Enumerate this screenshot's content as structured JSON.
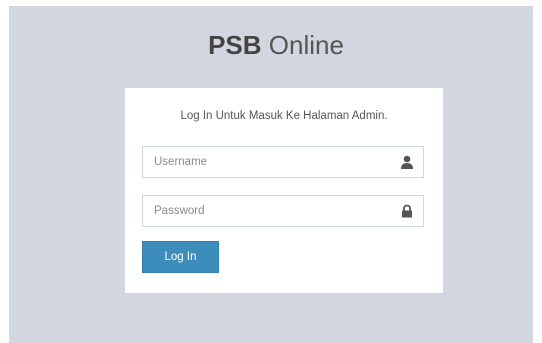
{
  "brand": {
    "strong": "PSB",
    "light": " Online"
  },
  "login_box": {
    "message": "Log In Untuk Masuk Ke Halaman Admin.",
    "username": {
      "placeholder": "Username",
      "value": "",
      "icon": "user-icon"
    },
    "password": {
      "placeholder": "Password",
      "value": "",
      "icon": "lock-icon"
    },
    "submit_label": "Log In"
  },
  "colors": {
    "page_background": "#d2d6de",
    "box_background": "#ffffff",
    "button_primary": "#3c8dbc",
    "icon_color": "#555555"
  }
}
